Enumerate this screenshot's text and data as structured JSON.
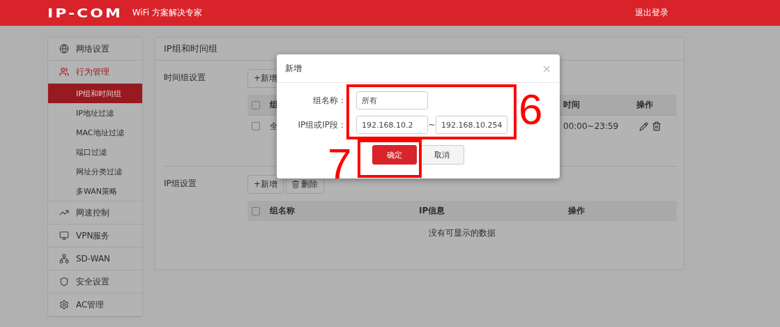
{
  "header": {
    "logo": "IP-COM",
    "tagline": "WiFi 方案解决专家",
    "logout": "退出登录"
  },
  "sidebar": {
    "items": [
      {
        "label": "网络设置",
        "selected": false
      },
      {
        "label": "行为管理",
        "selected": true,
        "expanded": true,
        "children": [
          {
            "label": "IP组和时间组",
            "selected": true
          },
          {
            "label": "IP地址过滤",
            "selected": false
          },
          {
            "label": "MAC地址过滤",
            "selected": false
          },
          {
            "label": "端口过滤",
            "selected": false
          },
          {
            "label": "网址分类过滤",
            "selected": false
          },
          {
            "label": "多WAN策略",
            "selected": false
          }
        ]
      },
      {
        "label": "网速控制",
        "selected": false
      },
      {
        "label": "VPN服务",
        "selected": false
      },
      {
        "label": "SD-WAN",
        "selected": false
      },
      {
        "label": "安全设置",
        "selected": false
      },
      {
        "label": "AC管理",
        "selected": false
      }
    ]
  },
  "panel": {
    "title": "IP组和时间组",
    "sections": [
      {
        "label": "时间组设置",
        "buttons": [
          {
            "label": "+新增",
            "kind": "add"
          }
        ],
        "table": {
          "columns": [
            {
              "label": "组",
              "checked": false
            },
            {
              "label": "时间"
            },
            {
              "label": "操作"
            }
          ],
          "rows": [
            {
              "checked": false,
              "cells": [
                "全",
                "00:00~23:59"
              ]
            }
          ]
        }
      },
      {
        "label": "IP组设置",
        "buttons": [
          {
            "label": "+新增",
            "kind": "add"
          },
          {
            "label": "删除",
            "kind": "delete"
          }
        ],
        "table": {
          "columns": [
            {
              "label": "组名称",
              "checked": false
            },
            {
              "label": "IP信息"
            },
            {
              "label": "操作"
            }
          ],
          "empty": "没有可显示的数据"
        }
      }
    ]
  },
  "dialog": {
    "title": "新增",
    "close": "×",
    "fields": [
      {
        "label": "组名称：",
        "values": [
          "所有"
        ]
      },
      {
        "label": "IP组或IP段：",
        "values": [
          "192.168.10.2",
          "192.168.10.254"
        ],
        "separator": "~"
      }
    ],
    "buttons": [
      {
        "label": "确定",
        "kind": "primary"
      },
      {
        "label": "取消",
        "kind": "secondary"
      }
    ]
  },
  "annotations": [
    {
      "label": "6"
    },
    {
      "label": "7"
    }
  ]
}
